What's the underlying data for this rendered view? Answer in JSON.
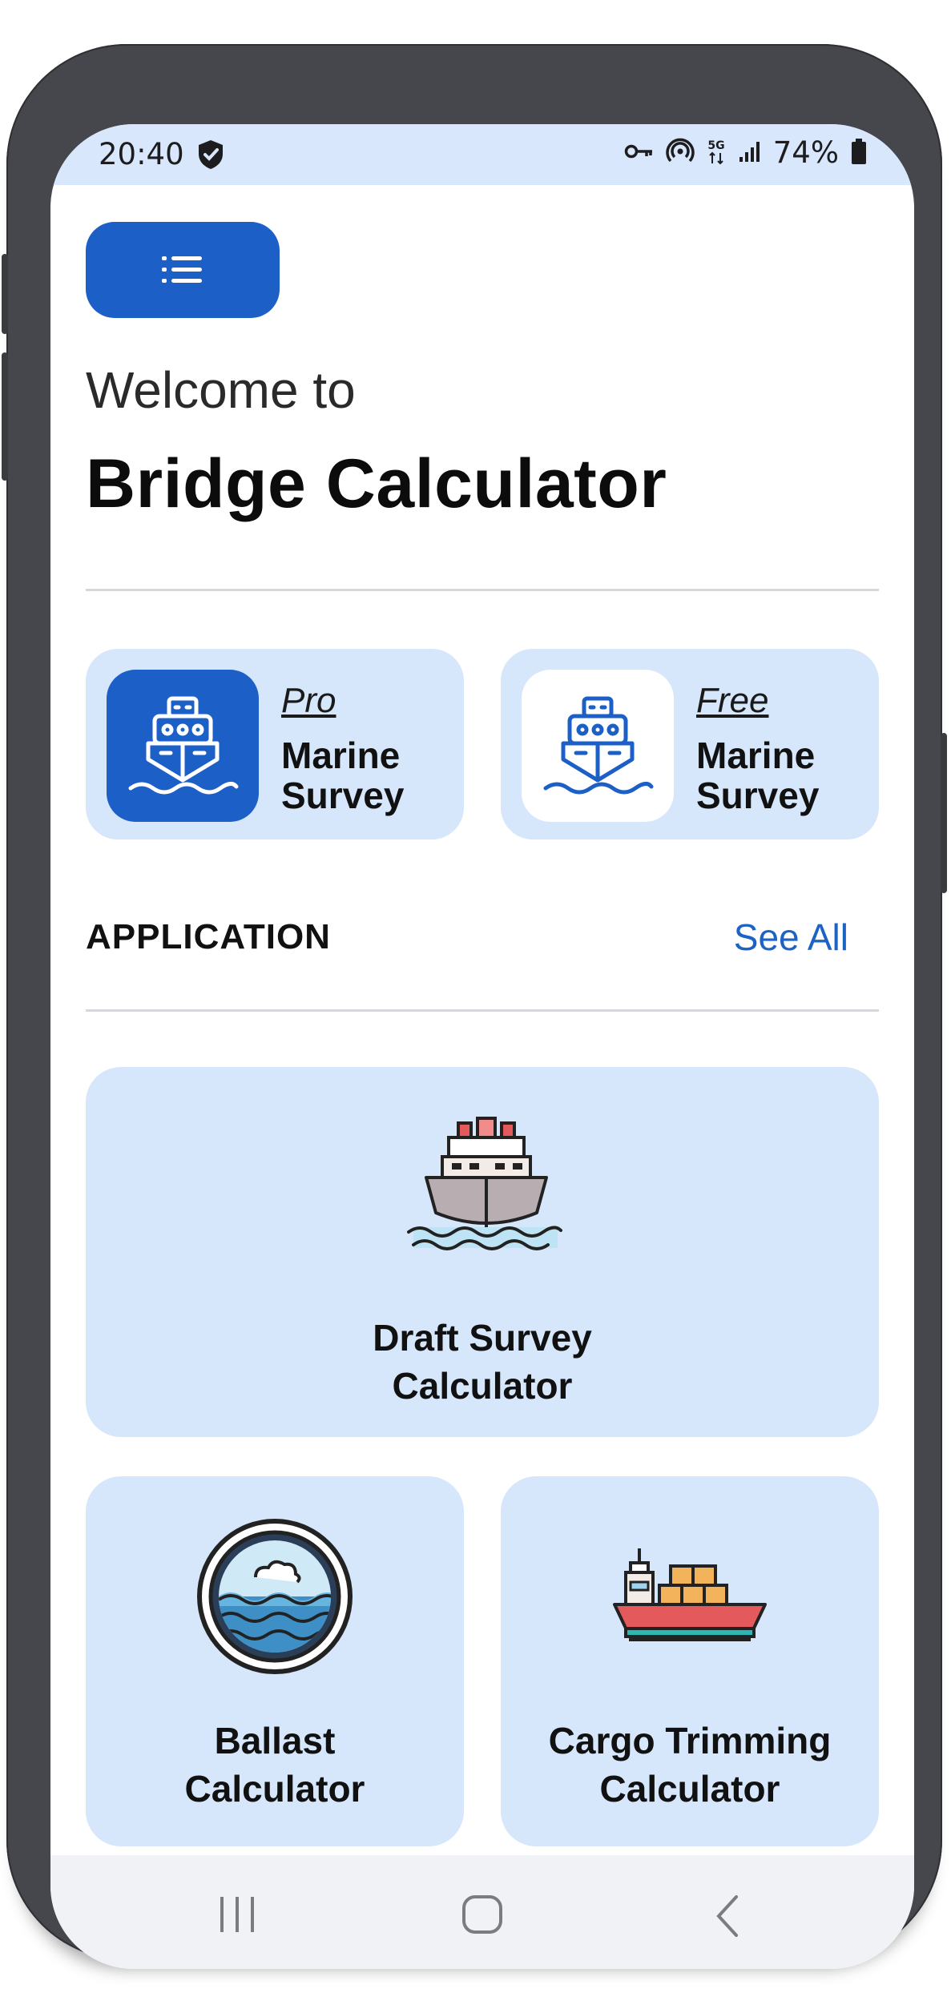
{
  "status_bar": {
    "time": "20:40",
    "battery": "74%",
    "icons": [
      "shield-icon",
      "key-icon",
      "hotspot-icon",
      "5g-icon",
      "signal-icon",
      "battery-icon"
    ]
  },
  "header": {
    "menu_icon": "menu-icon",
    "welcome": "Welcome to",
    "title": "Bridge Calculator"
  },
  "surveys": [
    {
      "tier": "Pro",
      "name_line1": "Marine",
      "name_line2": "Survey",
      "icon": "ship-icon"
    },
    {
      "tier": "Free",
      "name_line1": "Marine",
      "name_line2": "Survey",
      "icon": "ship-icon"
    }
  ],
  "section": {
    "title": "APPLICATION",
    "see_all": "See All"
  },
  "apps": [
    {
      "line1": "Draft Survey",
      "line2": "Calculator",
      "icon": "ship-icon"
    },
    {
      "line1": "Ballast",
      "line2": "Calculator",
      "icon": "water-porthole-icon"
    },
    {
      "line1": "Cargo Trimming",
      "line2": "Calculator",
      "icon": "cargo-ship-icon"
    }
  ],
  "nav_bar": {
    "icons": [
      "recent-apps-icon",
      "home-icon",
      "back-icon"
    ]
  },
  "colors": {
    "accent": "#1b5fc7",
    "card_bg": "#d6e6fb",
    "status_bar_bg": "#d8e7fb",
    "link": "#1c63c4"
  }
}
